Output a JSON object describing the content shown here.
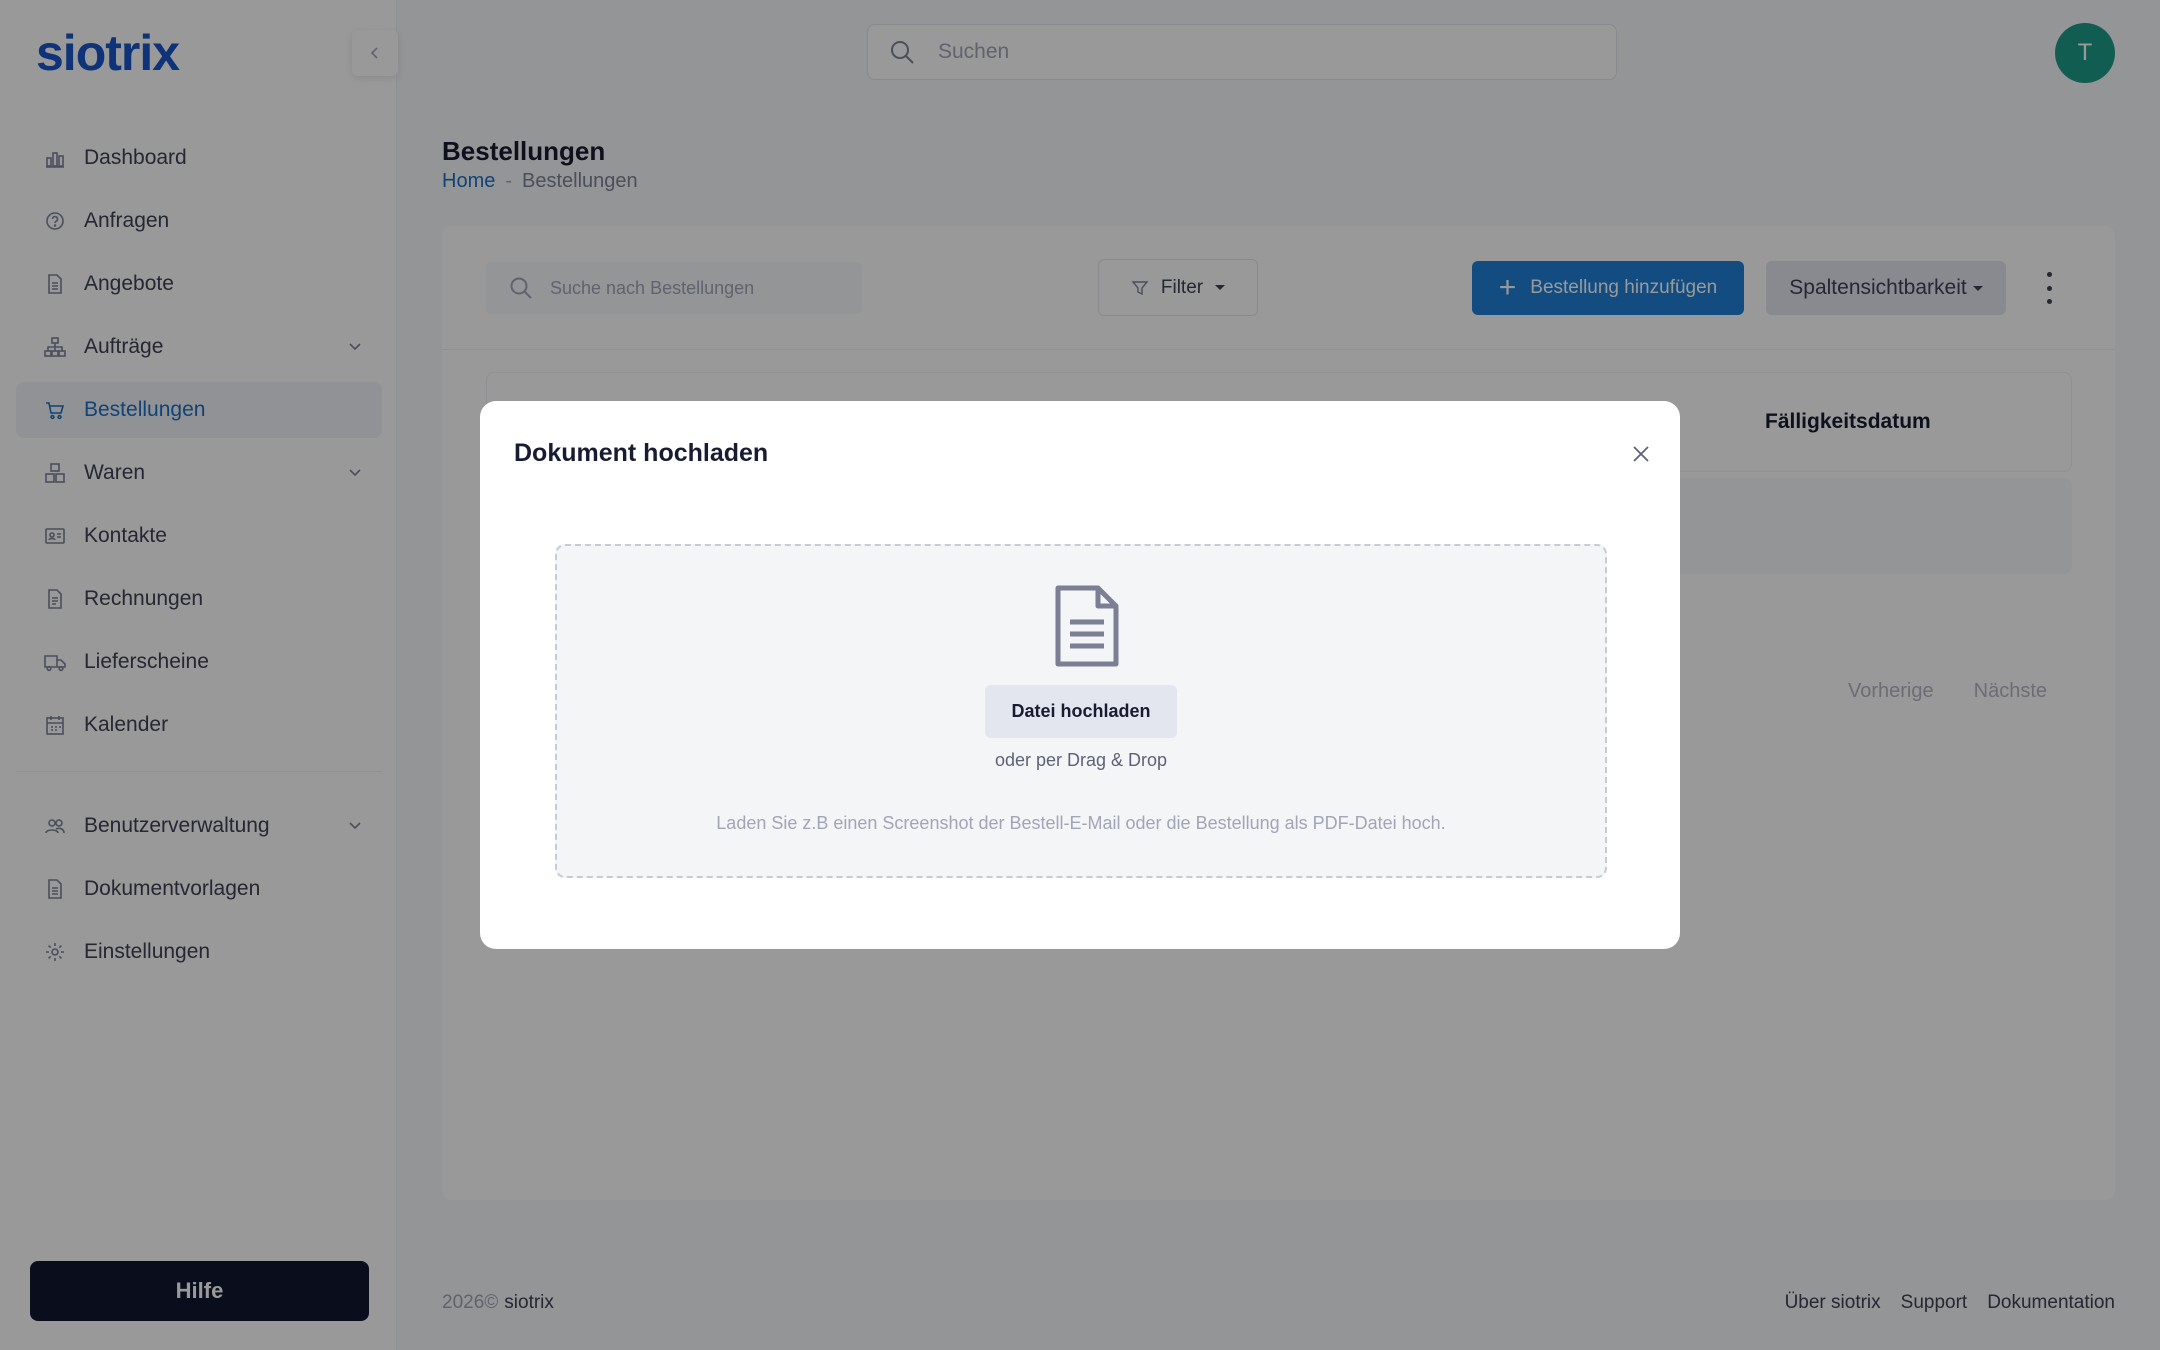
{
  "app": {
    "logo": "siotrix",
    "collapse_icon": "chevron-left-icon"
  },
  "header": {
    "search_placeholder": "Suchen",
    "avatar_initial": "T"
  },
  "sidebar": {
    "items": [
      {
        "label": "Dashboard",
        "icon": "bar-chart-icon"
      },
      {
        "label": "Anfragen",
        "icon": "question-circle-icon"
      },
      {
        "label": "Angebote",
        "icon": "document-icon"
      },
      {
        "label": "Aufträge",
        "icon": "hierarchy-icon",
        "expandable": true
      },
      {
        "label": "Bestellungen",
        "icon": "cart-icon",
        "active": true
      },
      {
        "label": "Waren",
        "icon": "boxes-icon",
        "expandable": true
      },
      {
        "label": "Kontakte",
        "icon": "contact-card-icon"
      },
      {
        "label": "Rechnungen",
        "icon": "invoice-icon"
      },
      {
        "label": "Lieferscheine",
        "icon": "truck-icon"
      },
      {
        "label": "Kalender",
        "icon": "calendar-icon"
      }
    ],
    "items2": [
      {
        "label": "Benutzerverwaltung",
        "icon": "users-icon",
        "expandable": true
      },
      {
        "label": "Dokumentvorlagen",
        "icon": "document-template-icon"
      },
      {
        "label": "Einstellungen",
        "icon": "gear-icon"
      }
    ],
    "help_label": "Hilfe"
  },
  "page": {
    "title": "Bestellungen",
    "breadcrumb": {
      "home": "Home",
      "separator": "-",
      "current": "Bestellungen"
    }
  },
  "toolbar": {
    "search_placeholder": "Suche nach Bestellungen",
    "filter_label": "Filter",
    "add_label": "Bestellung hinzufügen",
    "columns_label": "Spaltensichtbarkeit"
  },
  "table": {
    "visible_header": "Fälligkeitsdatum"
  },
  "pagination": {
    "prev": "Vorherige",
    "next": "Nächste"
  },
  "footer": {
    "year": "2026©",
    "brand": "siotrix",
    "links": [
      "Über siotrix",
      "Support",
      "Dokumentation"
    ]
  },
  "modal": {
    "title": "Dokument hochladen",
    "upload_button": "Datei hochladen",
    "drag_drop": "oder per Drag & Drop",
    "hint": "Laden Sie z.B einen Screenshot der Bestell-E-Mail oder die Bestellung als PDF-Datei hoch."
  },
  "colors": {
    "brand_blue": "#1a56c8",
    "primary": "#1e7fd8",
    "active_link": "#1e71c4",
    "help_bg": "#10162f",
    "avatar_bg": "#1e9c87"
  }
}
